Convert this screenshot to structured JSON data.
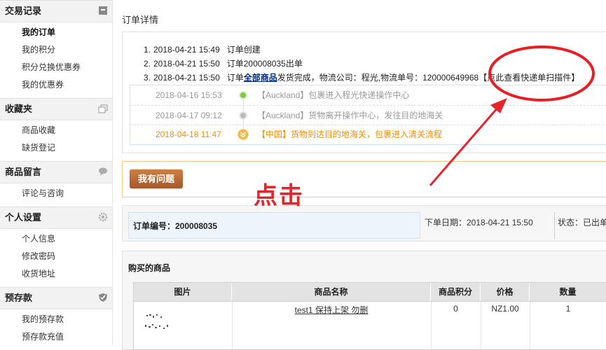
{
  "sidebar": {
    "sections": [
      {
        "title": "交易记录",
        "icon": "archive-icon",
        "items": [
          "我的订单",
          "我的积分",
          "积分兑换优惠券",
          "我的优惠券"
        ]
      },
      {
        "title": "收藏夹",
        "icon": "folders-icon",
        "items": [
          "商品收藏",
          "缺货登记"
        ]
      },
      {
        "title": "商品留言",
        "icon": "speech-bubble-icon",
        "items": [
          "评论与咨询"
        ]
      },
      {
        "title": "个人设置",
        "icon": "gear-icon",
        "items": [
          "个人信息",
          "修改密码",
          "收货地址"
        ]
      },
      {
        "title": "预存款",
        "icon": "shield-icon",
        "items": [
          "我的预存款",
          "预存款充值"
        ]
      }
    ]
  },
  "page_title": "订单详情",
  "order_log": [
    {
      "num": "1.",
      "time": "2018-04-21 15:49",
      "text": "订单创建"
    },
    {
      "num": "2.",
      "time": "2018-04-21 15:50",
      "text": "订单200008035出单"
    },
    {
      "num": "3.",
      "time": "2018-04-21 15:50",
      "prefix": "订单",
      "link": "全部商品",
      "text": "发货完成，物流公司：程光,物流单号：120000649968",
      "query_link": "【点此查看快递单扫描件】"
    }
  ],
  "tracking": [
    {
      "date": "2018-04-16 15:53",
      "text": "【Auckland】包裹进入程光快递操作中心"
    },
    {
      "date": "2018-04-17 09:12",
      "text": "【Auckland】货物离开操作中心，发往目的地海关"
    },
    {
      "date": "2018-04-18 11:47",
      "text": "【中国】货物到达目的地海关，包裹进入清关流程"
    }
  ],
  "question_button": "我有问题",
  "annotation": {
    "text": "点击",
    "color": "#e5252b"
  },
  "order_info": {
    "order_no_label": "订单编号：200008035",
    "order_date": "下单日期：2018-04-21 15:50",
    "status": "状态：已出单"
  },
  "goods": {
    "title": "购买的商品",
    "columns": [
      "图片",
      "商品名称",
      "商品积分",
      "价格",
      "数量"
    ],
    "rows": [
      {
        "name": "test1 保持上架 勿删",
        "points": "0",
        "price": "NZ1.00",
        "qty": "1"
      }
    ]
  },
  "colors": {
    "accent_orange": "#f18d00",
    "link_blue": "#002b80",
    "dot_green": "#7ac943"
  }
}
